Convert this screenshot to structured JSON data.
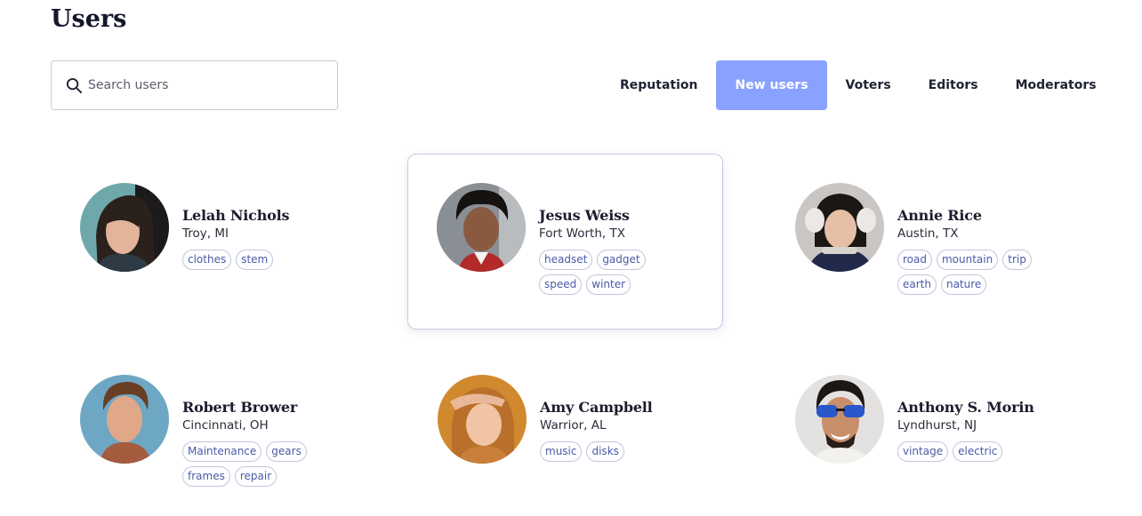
{
  "page": {
    "title": "Users"
  },
  "search": {
    "placeholder": "Search users",
    "icon": "search-icon"
  },
  "tabs": [
    {
      "label": "Reputation",
      "active": false
    },
    {
      "label": "New users",
      "active": true
    },
    {
      "label": "Voters",
      "active": false
    },
    {
      "label": "Editors",
      "active": false
    },
    {
      "label": "Moderators",
      "active": false
    }
  ],
  "colors": {
    "accent": "#8aa2ff",
    "tag_text": "#4a5aa8",
    "tag_border": "#c2c6dc"
  },
  "users": [
    {
      "name": "Lelah Nichols",
      "location": "Troy, MI",
      "tags": [
        "clothes",
        "stem"
      ]
    },
    {
      "name": "Jesus Weiss",
      "location": "Fort Worth, TX",
      "tags": [
        "headset",
        "gadget",
        "speed",
        "winter"
      ]
    },
    {
      "name": "Annie Rice",
      "location": "Austin, TX",
      "tags": [
        "road",
        "mountain",
        "trip",
        "earth",
        "nature"
      ]
    },
    {
      "name": "Robert Brower",
      "location": "Cincinnati, OH",
      "tags": [
        "Maintenance",
        "gears",
        "frames",
        "repair"
      ]
    },
    {
      "name": "Amy Campbell",
      "location": "Warrior, AL",
      "tags": [
        "music",
        "disks"
      ]
    },
    {
      "name": "Anthony S. Morin",
      "location": "Lyndhurst, NJ",
      "tags": [
        "vintage",
        "electric"
      ]
    }
  ]
}
